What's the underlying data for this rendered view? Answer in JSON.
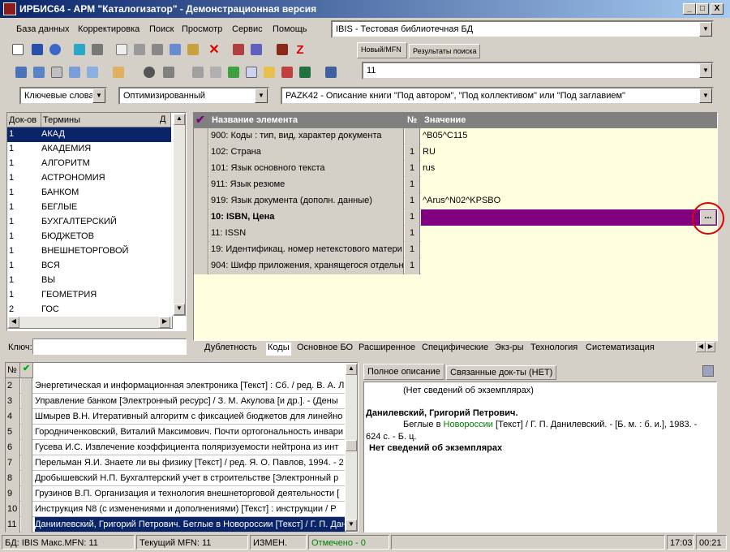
{
  "window": {
    "title": "ИРБИС64 - АРМ \"Каталогизатор\" - Демонстрационная версия",
    "btn_min": "_",
    "btn_max": "□",
    "btn_close": "X"
  },
  "menu": [
    "База данных",
    "Корректировка",
    "Поиск",
    "Просмотр",
    "Сервис",
    "Помощь"
  ],
  "database_combo": "IBIS - Тестовая библиотечная БД",
  "right_tabs": [
    "Новый/MFN",
    "Результаты поиска"
  ],
  "mfn_value": "11",
  "search_bar": {
    "mode": "Ключевые слова",
    "profile": "Оптимизированный",
    "worksheet": "PAZK42 - Описание книги \"Под автором\", \"Под коллективом\" или \"Под заглавием\""
  },
  "terms": {
    "header_docs": "Док-ов",
    "header_terms": "Термины",
    "header_pin": "Д",
    "rows": [
      {
        "docs": "1",
        "term": "АКАД"
      },
      {
        "docs": "1",
        "term": "АКАДЕМИЯ"
      },
      {
        "docs": "1",
        "term": "АЛГОРИТМ"
      },
      {
        "docs": "1",
        "term": "АСТРОНОМИЯ"
      },
      {
        "docs": "1",
        "term": "БАНКОМ"
      },
      {
        "docs": "1",
        "term": "БЕГЛЫЕ"
      },
      {
        "docs": "1",
        "term": "БУХГАЛТЕРСКИЙ"
      },
      {
        "docs": "1",
        "term": "БЮДЖЕТОВ"
      },
      {
        "docs": "1",
        "term": "ВНЕШНЕТОРГОВОЙ"
      },
      {
        "docs": "1",
        "term": "ВСЯ"
      },
      {
        "docs": "1",
        "term": "ВЫ"
      },
      {
        "docs": "1",
        "term": "ГЕОМЕТРИЯ"
      },
      {
        "docs": "2",
        "term": "ГОС"
      }
    ],
    "key_label": "Ключ:"
  },
  "elements": {
    "header_name": "Название элемента",
    "header_num": "№",
    "header_value": "Значение",
    "rows": [
      {
        "name": "900: Коды : тип, вид, характер документа",
        "num": "",
        "value": "^B05^C115"
      },
      {
        "name": "102: Страна",
        "num": "1",
        "value": "RU"
      },
      {
        "name": "101: Язык основного текста",
        "num": "1",
        "value": "rus"
      },
      {
        "name": "911: Язык резюме",
        "num": "1",
        "value": ""
      },
      {
        "name": "919: Язык документа (дополн. данные)",
        "num": "1",
        "value": "^Arus^N02^KPSBO"
      },
      {
        "name": "10: ISBN, Цена",
        "num": "1",
        "value": ""
      },
      {
        "name": "11: ISSN",
        "num": "1",
        "value": ""
      },
      {
        "name": "19: Идентификац. номер нетекстового матери",
        "num": "1",
        "value": ""
      },
      {
        "name": "904: Шифр приложения, хранящегося отдельно",
        "num": "1",
        "value": ""
      }
    ],
    "ellipsis": "..."
  },
  "bottom_tabs": [
    "Дублетность",
    "Коды",
    "Основное БО",
    "Расширенное",
    "Специфические",
    "Экз-ры",
    "Технология",
    "Систематизация"
  ],
  "records": {
    "header_num": "№",
    "rows": [
      {
        "n": "2",
        "text": "Энергетическая и информационная электроника [Текст] : Сб. / ред. В. А. Л"
      },
      {
        "n": "3",
        "text": "Управление банком [Электронный ресурс]  / З. М. Акулова [и др.]. - (Дены"
      },
      {
        "n": "4",
        "text": "Шмырев В.Н. Итеративный алгоритм с фиксацией бюджетов для линейно"
      },
      {
        "n": "5",
        "text": "Городниченковский, Виталий Максимович. Почти ортогональность инвари"
      },
      {
        "n": "6",
        "text": "Гусева И.С. Извлечение коэффициента поляризуемости нейтрона из инт"
      },
      {
        "n": "7",
        "text": "Перельман Я.И. Знаете ли вы физику [Текст] / ред. Я. О. Павлов, 1994. - 2"
      },
      {
        "n": "8",
        "text": "Дробышевский Н.П. Бухгалтерский учет в строительстве [Электронный р"
      },
      {
        "n": "9",
        "text": "Грузинов В.П. Организация и технология внешнеторговой деятельности ["
      },
      {
        "n": "10",
        "text": "Инструкция N8   (с изменениями и дополнениями) [Текст] : инструкции / Р"
      },
      {
        "n": "11",
        "text": "Даниилевский, Григорий Петрович. Беглые в Новороссии [Текст] / Г. П. Дан"
      }
    ]
  },
  "preview": {
    "tabs": [
      "Полное описание",
      "Связанные док-ты (НЕТ)"
    ],
    "no_copies_top": "(Нет сведений об экземплярах)",
    "author": "Данилевский, Григорий Петрович.",
    "desc_prefix": "Беглые в ",
    "desc_link": "Новороссии",
    "desc_suffix": " [Текст] / Г. П. Данилевский. - [Б. м. : б. и.], 1983. -",
    "desc_line2": "624 с. - Б. ц.",
    "no_copies_bottom": "Нет сведений об экземплярах"
  },
  "status": {
    "db": "БД: IBIS Макс.MFN: 11",
    "current": "Текущий MFN: 11",
    "changed": "ИЗМЕН.",
    "marked": "Отмечено - 0",
    "time": "17:03",
    "elapsed": "00:21"
  },
  "colors": {
    "title_start": "#0a246a",
    "selected_value": "#800080",
    "value_bg": "#ffffe0",
    "marked_text": "#008000",
    "red_circle": "#e00000"
  }
}
